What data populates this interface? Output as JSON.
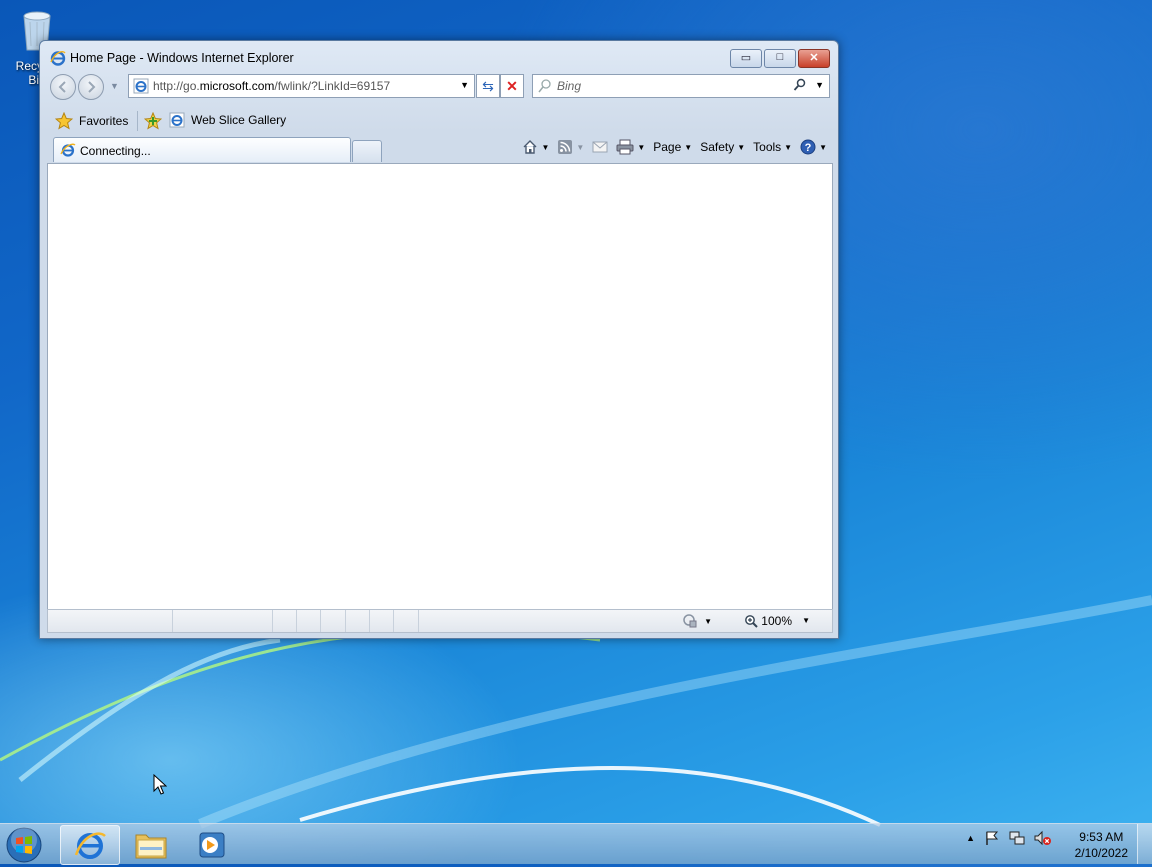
{
  "desktop": {
    "recycle_bin_label": "Recycle Bin"
  },
  "window": {
    "title": "Home Page - Windows Internet Explorer",
    "caption_buttons": {
      "minimize": "▭",
      "maximize": "□",
      "close": "✕"
    }
  },
  "navigation": {
    "address_prefix": "http://go.",
    "address_host": "microsoft.com",
    "address_suffix": "/fwlink/?LinkId=69157",
    "search_placeholder": "Bing"
  },
  "favorites_bar": {
    "favorites_label": "Favorites",
    "web_slice_label": "Web Slice Gallery"
  },
  "tabs": {
    "active_tab_label": "Connecting..."
  },
  "command_bar": {
    "page_label": "Page",
    "safety_label": "Safety",
    "tools_label": "Tools"
  },
  "status_bar": {
    "zoom": "100%"
  },
  "taskbar": {
    "time": "9:53 AM",
    "date": "2/10/2022"
  },
  "colors": {
    "accent": "#1167c8",
    "close_button": "#c8402a"
  }
}
